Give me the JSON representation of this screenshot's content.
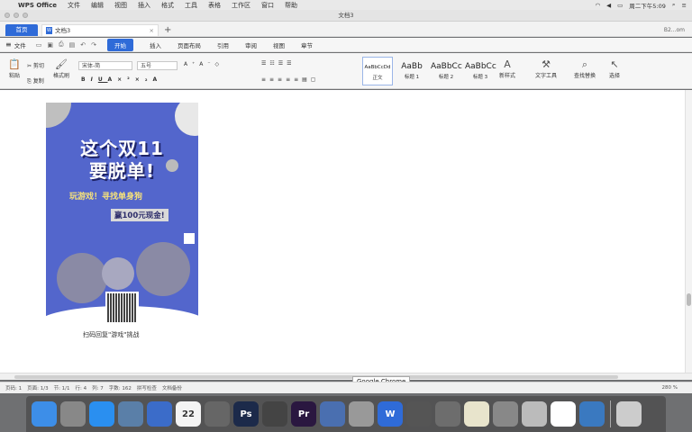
{
  "menubar": {
    "apple": "",
    "app_name": "WPS Office",
    "items": [
      "文件",
      "编辑",
      "视图",
      "插入",
      "格式",
      "工具",
      "表格",
      "工作区",
      "窗口",
      "帮助"
    ],
    "clock": "周二下午5:09"
  },
  "window": {
    "title": "文档3"
  },
  "tabs": {
    "home": "首页",
    "doc": "文档3",
    "user": "B2...om"
  },
  "ribbon_tabs": {
    "file": "文件",
    "tabs": [
      "开始",
      "插入",
      "页面布局",
      "引用",
      "审阅",
      "视图",
      "章节"
    ],
    "active": "开始"
  },
  "ribbon": {
    "paste": "粘贴",
    "cut": "剪切",
    "copy": "复制",
    "format_painter": "格式刷",
    "font_name": "宋体-简",
    "font_size": "五号",
    "styles": [
      {
        "sample": "AaBbCcDd",
        "label": "正文"
      },
      {
        "sample": "AaBb",
        "label": "标题 1"
      },
      {
        "sample": "AaBbCc",
        "label": "标题 2"
      },
      {
        "sample": "AaBbCc",
        "label": "标题 3"
      }
    ],
    "new_style": "新样式",
    "text_tools": "文字工具",
    "find_replace": "查找替换",
    "select": "选择"
  },
  "poster": {
    "line1": "这个双11",
    "line2": "要脱单!",
    "line3": "玩游戏！寻找单身狗",
    "line4": "赢100元现金!",
    "caption": "扫码回复\"游戏\"挑战"
  },
  "tooltip": "Google Chrome",
  "statusbar": {
    "page": "页码: 1",
    "pages": "页面: 1/3",
    "section": "节: 1/1",
    "row": "行: 4",
    "col": "列: 7",
    "words": "字数: 162",
    "spell": "拼写检查",
    "backup": "文档备份",
    "zoom": "280 %"
  },
  "dock": {
    "apps": [
      {
        "icon": "finder-icon",
        "color": "#3d8ee8",
        "label": ""
      },
      {
        "icon": "launchpad-icon",
        "color": "#888",
        "label": ""
      },
      {
        "icon": "app-store-icon",
        "color": "#2a8ff0",
        "label": ""
      },
      {
        "icon": "image-capture-icon",
        "color": "#5a7fa8",
        "label": ""
      },
      {
        "icon": "xcode-icon",
        "color": "#3b6cc9",
        "label": ""
      },
      {
        "icon": "calendar-icon",
        "color": "#f4f4f4",
        "label": "22"
      },
      {
        "icon": "vmware-icon",
        "color": "#666",
        "label": ""
      },
      {
        "icon": "photoshop-icon",
        "color": "#1c2a4a",
        "label": "Ps"
      },
      {
        "icon": "compressor-icon",
        "color": "#444",
        "label": ""
      },
      {
        "icon": "premiere-icon",
        "color": "#2a1740",
        "label": "Pr"
      },
      {
        "icon": "keynote-icon",
        "color": "#4a6fb0",
        "label": ""
      },
      {
        "icon": "chrome-icon",
        "color": "#999",
        "label": ""
      },
      {
        "icon": "wps-icon",
        "color": "#2f6bd8",
        "label": "W"
      },
      {
        "icon": "qq-icon",
        "color": "#555",
        "label": ""
      },
      {
        "icon": "wechat-icon",
        "color": "#6d6d6d",
        "label": ""
      },
      {
        "icon": "notes-icon",
        "color": "#e8e4cc",
        "label": ""
      },
      {
        "icon": "preview-icon",
        "color": "#888",
        "label": ""
      },
      {
        "icon": "doc-icon",
        "color": "#bbb",
        "label": ""
      },
      {
        "icon": "baidu-netdisk-icon",
        "color": "#fff",
        "label": ""
      },
      {
        "icon": "network-icon",
        "color": "#3a79c0",
        "label": ""
      },
      {
        "icon": "trash-icon",
        "color": "#ccc",
        "label": ""
      }
    ]
  }
}
